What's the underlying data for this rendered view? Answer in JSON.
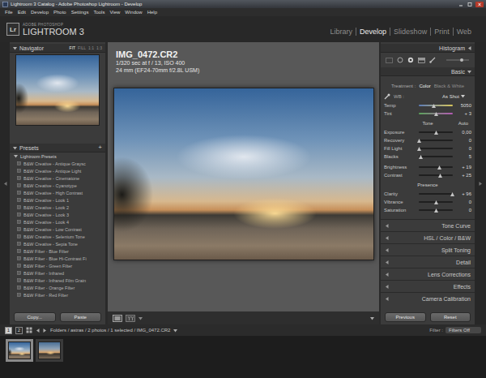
{
  "window": {
    "title": "Lightroom 3 Catalog - Adobe Photoshop Lightroom - Develop"
  },
  "menu": [
    "File",
    "Edit",
    "Develop",
    "Photo",
    "Settings",
    "Tools",
    "View",
    "Window",
    "Help"
  ],
  "identity": {
    "logo": "Lr",
    "brand": "ADOBE PHOTOSHOP",
    "product": "LIGHTROOM 3"
  },
  "modules": [
    {
      "label": "Library",
      "selected": false
    },
    {
      "label": "Develop",
      "selected": true
    },
    {
      "label": "Slideshow",
      "selected": false
    },
    {
      "label": "Print",
      "selected": false
    },
    {
      "label": "Web",
      "selected": false
    }
  ],
  "navigator": {
    "title": "Navigator",
    "expanded": true,
    "zoom": [
      {
        "label": "FIT",
        "selected": true
      },
      {
        "label": "FILL",
        "selected": false
      },
      {
        "label": "1:1",
        "selected": false
      },
      {
        "label": "1:3",
        "selected": false
      }
    ]
  },
  "presets": {
    "title": "Presets",
    "expanded": true,
    "add": "+",
    "folder": {
      "name": "Lightroom Presets",
      "expanded": true
    },
    "items": [
      "B&W Creative - Antique Graysc",
      "B&W Creative - Antique Light",
      "B&W Creative - Cinematone",
      "B&W Creative - Cyanotype",
      "B&W Creative - High Contrast",
      "B&W Creative - Look 1",
      "B&W Creative - Look 2",
      "B&W Creative - Look 3",
      "B&W Creative - Look 4",
      "B&W Creative - Low Contrast",
      "B&W Creative - Selenium Tone",
      "B&W Creative - Sepia Tone",
      "B&W Filter - Blue Filter",
      "B&W Filter - Blue Hi-Contrast Fi",
      "B&W Filter - Green Filter",
      "B&W Filter - Infrared",
      "B&W Filter - Infrared Film Grain",
      "B&W Filter - Orange Filter",
      "B&W Filter - Red Filter"
    ]
  },
  "left_buttons": [
    "Copy...",
    "Paste"
  ],
  "photo": {
    "name": "IMG_0472.CR2",
    "exposure": "1/320 sec at f / 13, ISO 400",
    "lens": "24 mm (EF24-70mm f/2.8L USM)"
  },
  "right_panel": {
    "histogram": {
      "title": "Histogram",
      "expanded": false
    },
    "basic": {
      "title": "Basic",
      "expanded": true,
      "treatment_label": "Treatment :",
      "treatments": [
        {
          "label": "Color",
          "selected": true
        },
        {
          "label": "Black & White",
          "selected": false
        }
      ],
      "wb_label": "WB :",
      "wb_value": "As Shot",
      "wb_sliders": [
        {
          "label": "Temp",
          "value": "5050",
          "level": 0.44,
          "kind": "temp"
        },
        {
          "label": "Tint",
          "value": "+ 3",
          "level": 0.52,
          "kind": "tint"
        }
      ],
      "tone_label": "Tone",
      "auto": "Auto",
      "tone_sliders": [
        {
          "label": "Exposure",
          "value": "0,00",
          "level": 0.5,
          "kind": "plain"
        },
        {
          "label": "Recovery",
          "value": "0",
          "level": 0.0,
          "kind": "plain"
        },
        {
          "label": "Fill Light",
          "value": "0",
          "level": 0.0,
          "kind": "plain"
        },
        {
          "label": "Blacks",
          "value": "5",
          "level": 0.05,
          "kind": "plain"
        }
      ],
      "tone_sliders_2": [
        {
          "label": "Brightness",
          "value": "+ 19",
          "level": 0.6,
          "kind": "plain"
        },
        {
          "label": "Contrast",
          "value": "+ 25",
          "level": 0.62,
          "kind": "plain"
        }
      ],
      "presence_label": "Presence",
      "presence_sliders": [
        {
          "label": "Clarity",
          "value": "+ 96",
          "level": 0.98,
          "kind": "plain"
        },
        {
          "label": "Vibrance",
          "value": "0",
          "level": 0.5,
          "kind": "plain"
        },
        {
          "label": "Saturation",
          "value": "0",
          "level": 0.5,
          "kind": "plain"
        }
      ]
    },
    "sections": [
      {
        "title": "Tone Curve",
        "expanded": false
      },
      {
        "title": "HSL / Color / B&W",
        "expanded": false
      },
      {
        "title": "Split Toning",
        "expanded": false
      },
      {
        "title": "Detail",
        "expanded": false
      },
      {
        "title": "Lens Corrections",
        "expanded": false
      },
      {
        "title": "Effects",
        "expanded": false
      },
      {
        "title": "Camera Calibration",
        "expanded": false
      }
    ],
    "buttons": [
      "Previous",
      "Reset"
    ]
  },
  "filmstrip": {
    "monitors": [
      {
        "label": "1",
        "selected": true
      },
      {
        "label": "2",
        "selected": false
      }
    ],
    "path": "Folders / astras / 2 photos / 1 selected / IMG_0472.CR2",
    "filter_label": "Filter :",
    "filter_value": "Filters Off",
    "thumbs": [
      {
        "selected": true
      },
      {
        "selected": false
      }
    ]
  }
}
